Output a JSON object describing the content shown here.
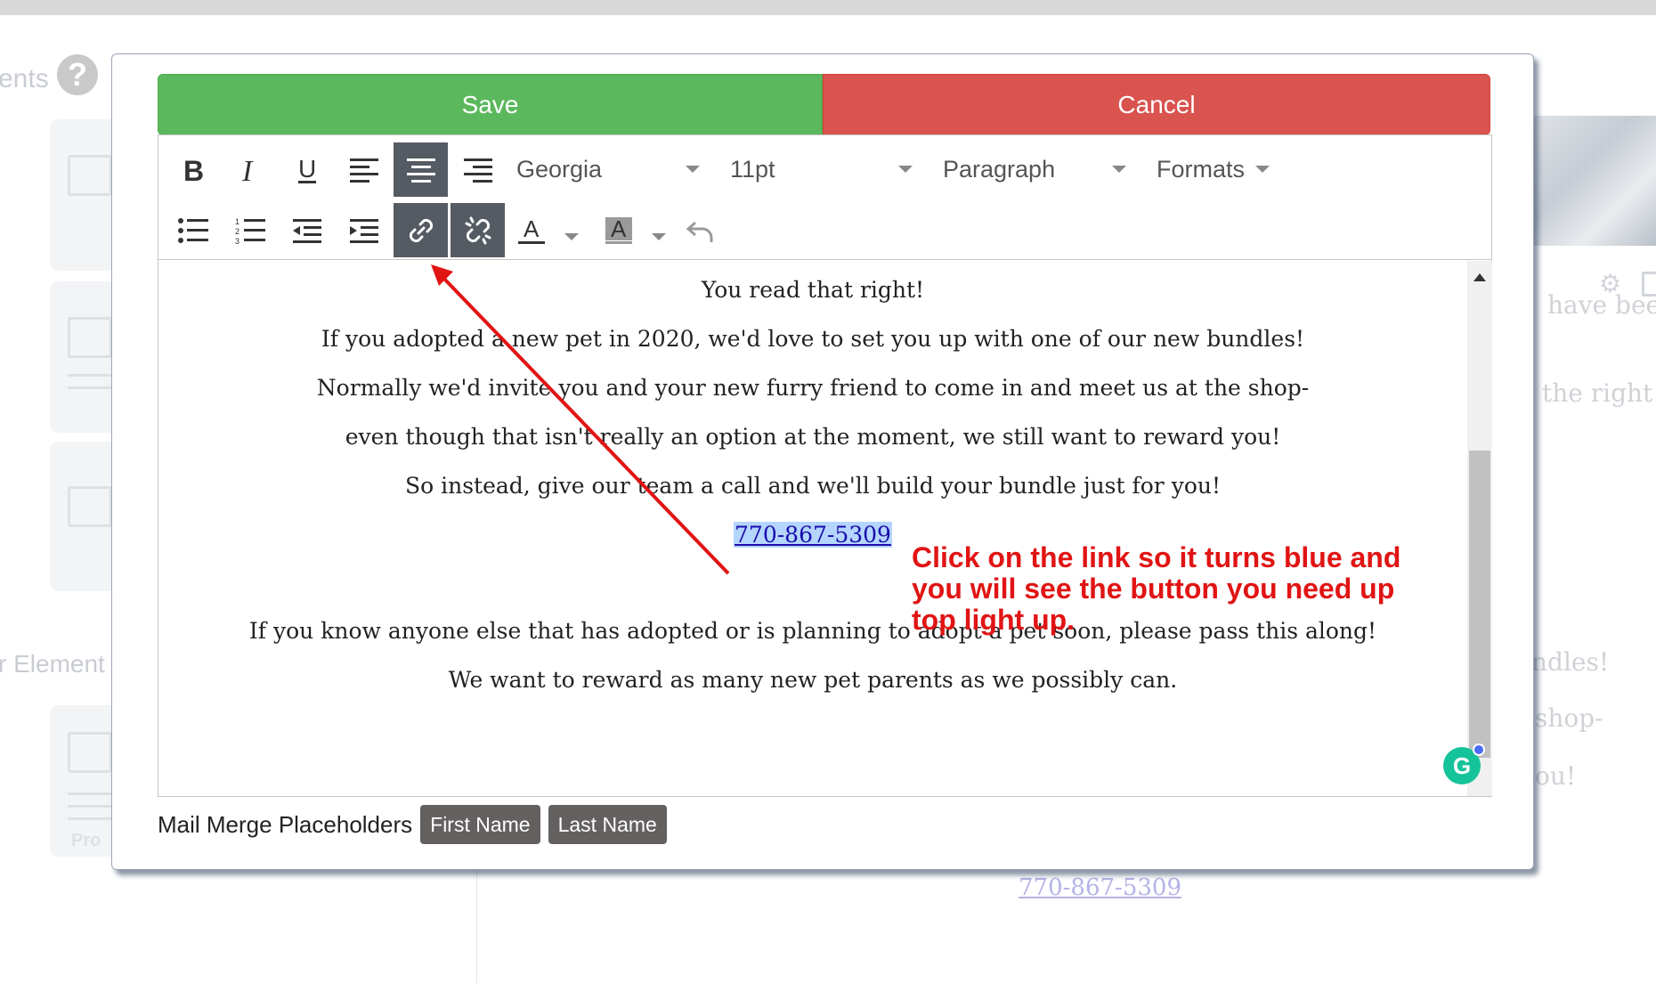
{
  "background": {
    "left_partial_1": "ents",
    "help_icon": "?",
    "left_partial_2": "r Element",
    "card_label": "Pro",
    "right_fragments": [
      "have been",
      "the right",
      "ndles!",
      "shop-",
      "ou!"
    ],
    "link_preview": "770-867-5309"
  },
  "modal": {
    "save_label": "Save",
    "cancel_label": "Cancel",
    "toolbar": {
      "font_family": "Georgia",
      "font_size": "11pt",
      "block_format": "Paragraph",
      "formats": "Formats",
      "text_color_letter": "A",
      "bg_color_letter": "A"
    },
    "content": {
      "lines": [
        "You read that right!",
        "If you adopted a new pet in 2020, we'd love to set you up with one of our new bundles!",
        "Normally we'd invite you and your new furry friend to come in and meet us at the shop-",
        "even though that isn't really an option at the moment, we still want to reward you!",
        "So instead, give our team a call and we'll build your bundle just for you!"
      ],
      "phone_link": "770-867-5309",
      "lines_after": [
        "If you know anyone else that has adopted or is planning to adopt a pet soon, please pass this along!",
        "We want to reward as many new pet parents as we possibly can."
      ]
    },
    "grammarly_letter": "G",
    "merge": {
      "label": "Mail Merge Placeholders",
      "first_name": "First Name",
      "last_name": "Last Name"
    }
  },
  "annotation": {
    "callout_text": "Click on the link so it turns blue and you will see the button you need up top light up.",
    "color": "#e11414"
  },
  "colors": {
    "save": "#5cb85c",
    "cancel": "#d9534f",
    "active_button": "#555b63",
    "selection": "#b4d5fe"
  }
}
